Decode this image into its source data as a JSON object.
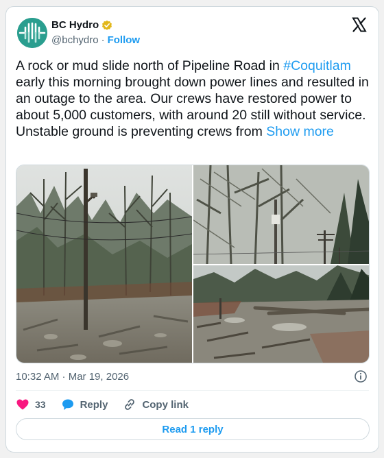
{
  "author": {
    "name": "BC Hydro",
    "handle": "@bchydro",
    "separator": "·",
    "follow_label": "Follow",
    "verified_badge_icon": "verified-badge-icon",
    "avatar_color": "#2a9e8f"
  },
  "tweet": {
    "text_before_hashtag": "A rock or mud slide north of Pipeline Road in ",
    "hashtag": "#Coquitlam",
    "text_after_hashtag": " early this morning brought down power lines and resulted in an outage to the area. Our crews have restored power to about 5,000 customers, with around 20 still without service. Unstable ground is preventing crews from ",
    "show_more": "Show more"
  },
  "media": {
    "photos": [
      {
        "name": "photo-power-pole-mudslide"
      },
      {
        "name": "photo-forest-power-lines"
      },
      {
        "name": "photo-debris-logs"
      }
    ]
  },
  "meta": {
    "timestamp": "10:32 AM · Mar 19, 2026"
  },
  "actions": {
    "like_count": "33",
    "reply_label": "Reply",
    "copy_link_label": "Copy link",
    "read_reply_label": "Read 1 reply"
  },
  "colors": {
    "accent": "#1d9bf0",
    "like": "#f91880",
    "secondary_text": "#536471",
    "border": "#cfd9de"
  }
}
